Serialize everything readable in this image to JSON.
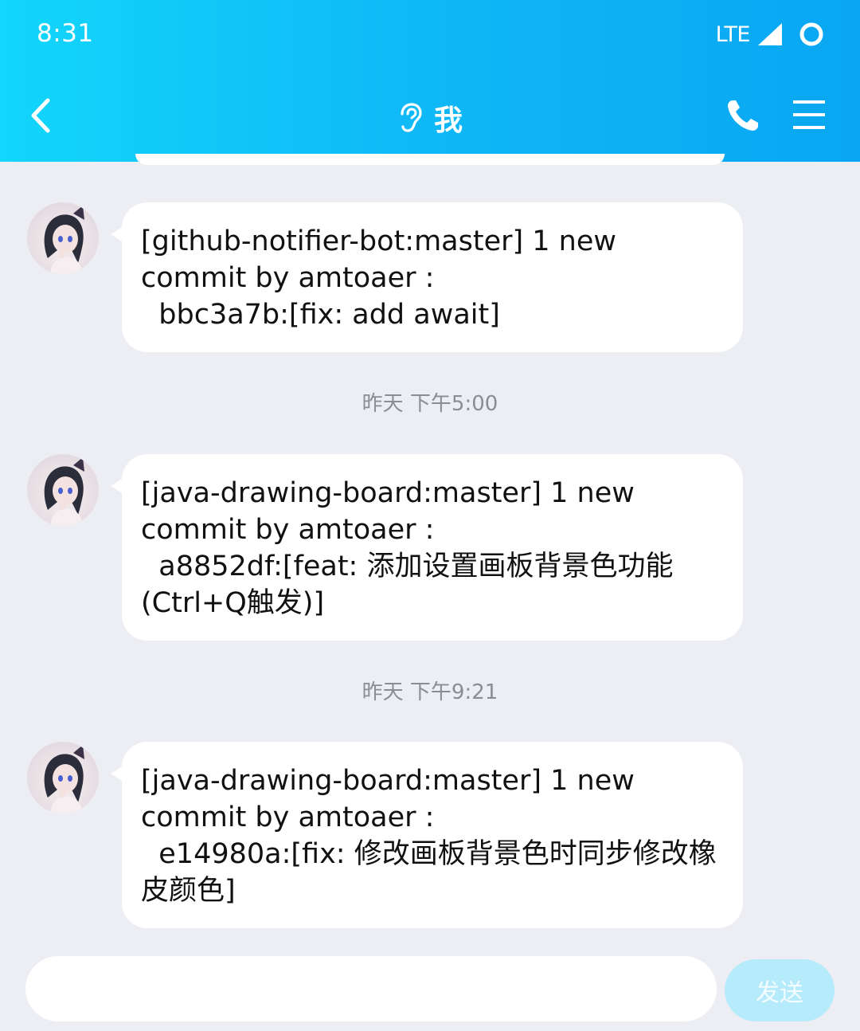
{
  "status_bar": {
    "time": "8:31",
    "network": "LTE"
  },
  "header": {
    "title": "我",
    "icons": [
      "back-icon",
      "ear-icon",
      "phone-icon",
      "menu-icon"
    ],
    "gradient": [
      "#12d6fb",
      "#0aa6f3"
    ]
  },
  "messages": [
    {
      "sender_avatar": "avatar",
      "text": "[github-notifier-bot:master] 1 new commit by amtoaer :\n  bbc3a7b:[fix: add await]"
    },
    {
      "sender_avatar": "avatar",
      "text": "[java-drawing-board:master] 1 new commit by amtoaer :\n  a8852df:[feat: 添加设置画板背景色功能(Ctrl+Q触发)]"
    },
    {
      "sender_avatar": "avatar",
      "text": "[java-drawing-board:master] 1 new commit by amtoaer :\n  e14980a:[fix: 修改画板背景色时同步修改橡皮颜色]"
    }
  ],
  "timestamps": [
    "昨天 下午5:00",
    "昨天 下午9:21"
  ],
  "input": {
    "value": "",
    "placeholder": "",
    "send_label": "发送"
  }
}
